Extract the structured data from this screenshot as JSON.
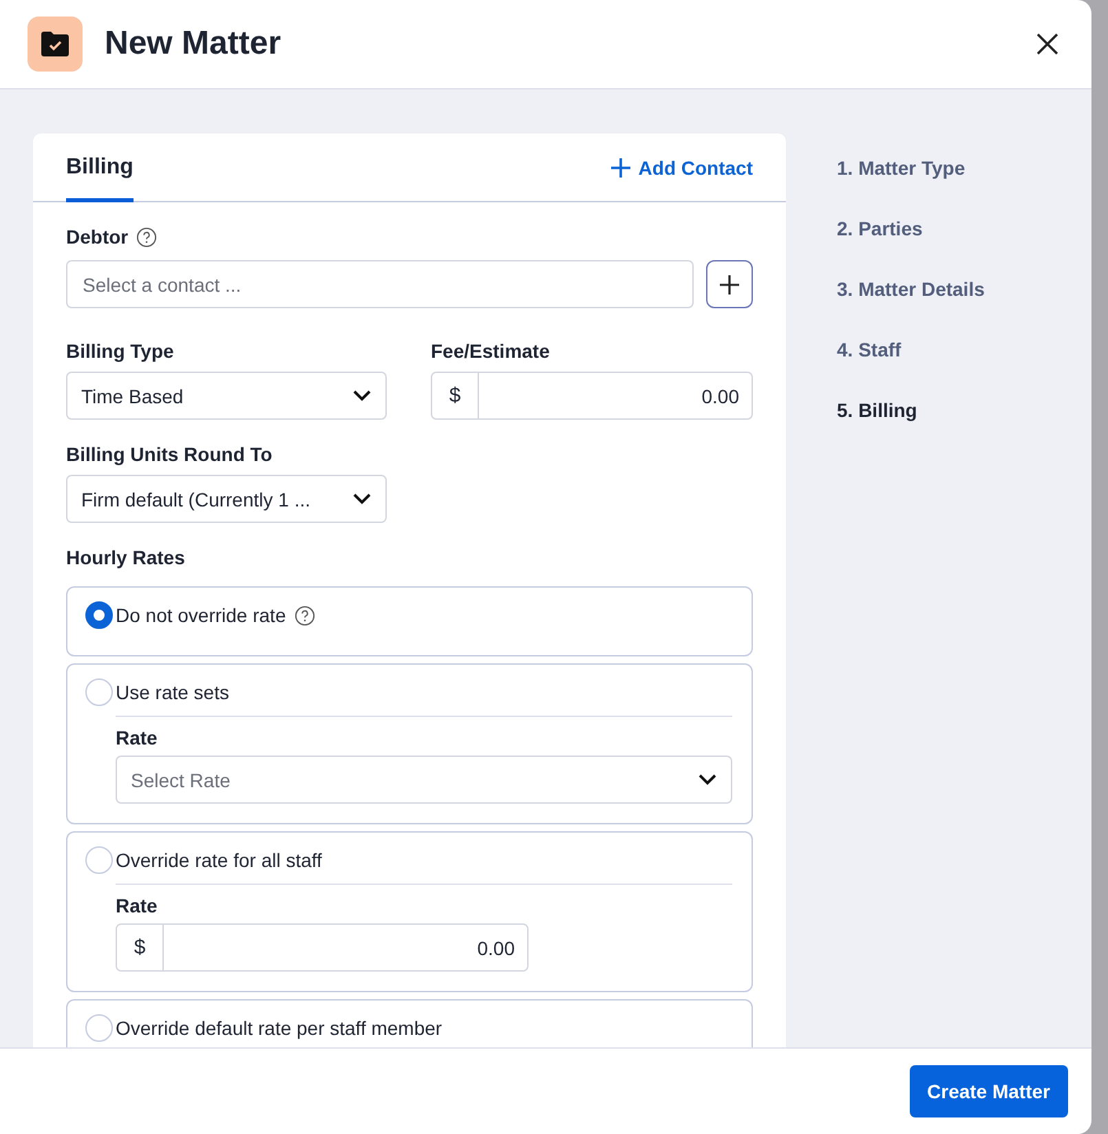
{
  "dialog": {
    "title": "New Matter"
  },
  "card": {
    "tabs": [
      {
        "label": "Billing",
        "selected": true
      }
    ],
    "add_contact": "Add Contact"
  },
  "debtor": {
    "label": "Debtor",
    "placeholder": "Select a contact ..."
  },
  "billing_type": {
    "label": "Billing Type",
    "value": "Time Based"
  },
  "fee_estimate": {
    "label": "Fee/Estimate",
    "prefix": "$",
    "value": "0.00"
  },
  "billing_units": {
    "label": "Billing Units Round To",
    "value": "Firm default (Currently 1 ..."
  },
  "hourly_rates": {
    "label": "Hourly Rates",
    "options": [
      {
        "kind": "plain",
        "label": "Do not override rate",
        "selected": true,
        "help": true
      },
      {
        "kind": "select",
        "label": "Use rate sets",
        "selected": false,
        "field_label": "Rate",
        "placeholder": "Select Rate"
      },
      {
        "kind": "amount",
        "label": "Override rate for all staff",
        "selected": false,
        "field_label": "Rate",
        "prefix": "$",
        "value": "0.00"
      },
      {
        "kind": "plain",
        "label": "Override default rate per staff member",
        "selected": false
      }
    ]
  },
  "steps": [
    {
      "label": "1. Matter Type",
      "selected": false
    },
    {
      "label": "2. Parties",
      "selected": false
    },
    {
      "label": "3. Matter Details",
      "selected": false
    },
    {
      "label": "4. Staff",
      "selected": false
    },
    {
      "label": "5. Billing",
      "selected": true
    }
  ],
  "footer": {
    "button": "Create Matter"
  }
}
